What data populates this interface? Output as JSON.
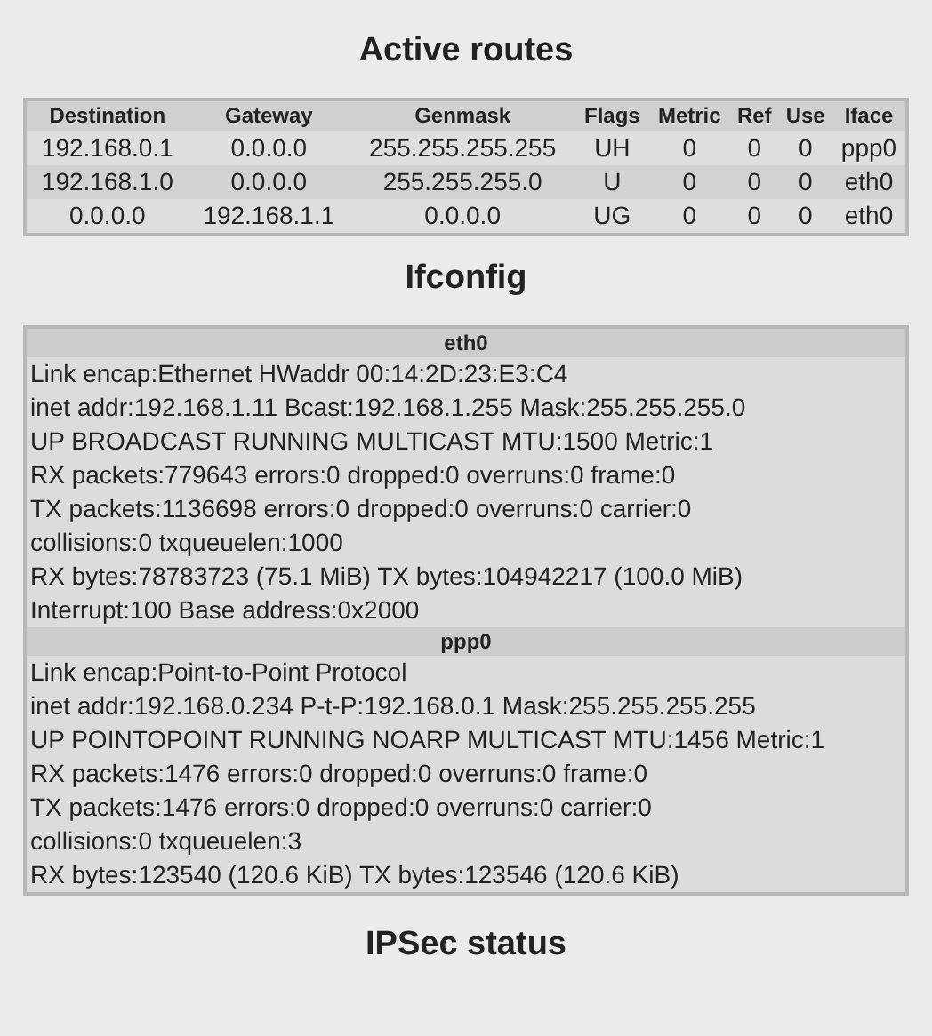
{
  "sections": [
    {
      "title": "Active routes"
    },
    {
      "title": "Ifconfig"
    },
    {
      "title": "IPSec status"
    }
  ],
  "routes": {
    "columns": [
      "Destination",
      "Gateway",
      "Genmask",
      "Flags",
      "Metric",
      "Ref",
      "Use",
      "Iface"
    ],
    "rows": [
      [
        "192.168.0.1",
        "0.0.0.0",
        "255.255.255.255",
        "UH",
        "0",
        "0",
        "0",
        "ppp0"
      ],
      [
        "192.168.1.0",
        "0.0.0.0",
        "255.255.255.0",
        "U",
        "0",
        "0",
        "0",
        "eth0"
      ],
      [
        "0.0.0.0",
        "192.168.1.1",
        "0.0.0.0",
        "UG",
        "0",
        "0",
        "0",
        "eth0"
      ]
    ]
  },
  "interfaces": [
    {
      "name": "eth0",
      "lines": [
        "Link encap:Ethernet HWaddr 00:14:2D:23:E3:C4",
        "inet addr:192.168.1.11 Bcast:192.168.1.255 Mask:255.255.255.0",
        "UP BROADCAST RUNNING MULTICAST MTU:1500 Metric:1",
        "RX packets:779643 errors:0 dropped:0 overruns:0 frame:0",
        "TX packets:1136698 errors:0 dropped:0 overruns:0 carrier:0",
        "collisions:0 txqueuelen:1000",
        "RX bytes:78783723 (75.1 MiB) TX bytes:104942217 (100.0 MiB)",
        "Interrupt:100 Base address:0x2000"
      ]
    },
    {
      "name": "ppp0",
      "lines": [
        "Link encap:Point-to-Point Protocol",
        "inet addr:192.168.0.234 P-t-P:192.168.0.1 Mask:255.255.255.255",
        "UP POINTOPOINT RUNNING NOARP MULTICAST MTU:1456 Metric:1",
        "RX packets:1476 errors:0 dropped:0 overruns:0 frame:0",
        "TX packets:1476 errors:0 dropped:0 overruns:0 carrier:0",
        "collisions:0 txqueuelen:3",
        "RX bytes:123540 (120.6 KiB) TX bytes:123546 (120.6 KiB)"
      ]
    }
  ]
}
